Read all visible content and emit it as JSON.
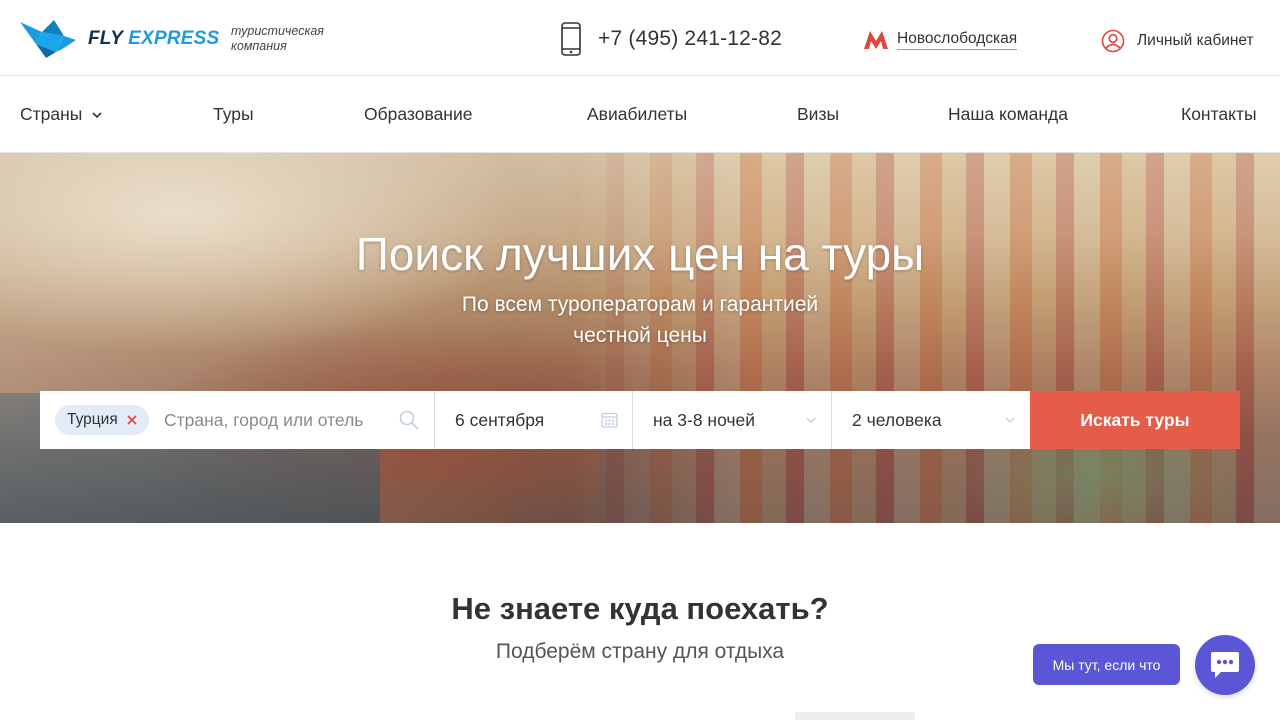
{
  "header": {
    "logo": {
      "fly": "FLY",
      "express": "EXPRESS",
      "subtitle": "туристическая компания"
    },
    "phone": "+7 (495) 241-12-82",
    "metro": "Новослободская",
    "account": "Личный кабинет"
  },
  "nav": {
    "items": [
      {
        "label": "Страны",
        "has_dropdown": true
      },
      {
        "label": "Туры"
      },
      {
        "label": "Образование"
      },
      {
        "label": "Авиабилеты"
      },
      {
        "label": "Визы"
      },
      {
        "label": "Наша команда"
      },
      {
        "label": "Контакты"
      }
    ]
  },
  "hero": {
    "title": "Поиск лучших цен на туры",
    "subtitle_line1": "По всем туроператорам и гарантией",
    "subtitle_line2": "честной цены"
  },
  "search": {
    "chip": "Турция",
    "destination_placeholder": "Страна, город или отель",
    "destination_value": "",
    "date": "6 сентября",
    "nights": "на 3-8 ночей",
    "people": "2 человека",
    "button": "Искать туры"
  },
  "section": {
    "title": "Не знаете куда поехать?",
    "subtitle": "Подберём страну для отдыха"
  },
  "chat": {
    "bubble": "Мы тут, если что"
  },
  "colors": {
    "logo_dark": "#12314f",
    "logo_blue": "#1e9be0",
    "metro_red": "#e0453d",
    "search_button": "#e55d49",
    "chip_bg": "#e3ebf6",
    "chat": "#5b56d6"
  },
  "icons": {
    "logo": "bird-logo-icon",
    "phone": "mobile-phone-icon",
    "metro": "metro-m-icon",
    "account": "user-circle-icon",
    "nav_dropdown": "chevron-down-icon",
    "chip_remove": "close-icon",
    "search": "search-icon",
    "date": "calendar-icon",
    "dropdown": "chevron-down-icon",
    "chat": "chat-bubble-icon"
  }
}
